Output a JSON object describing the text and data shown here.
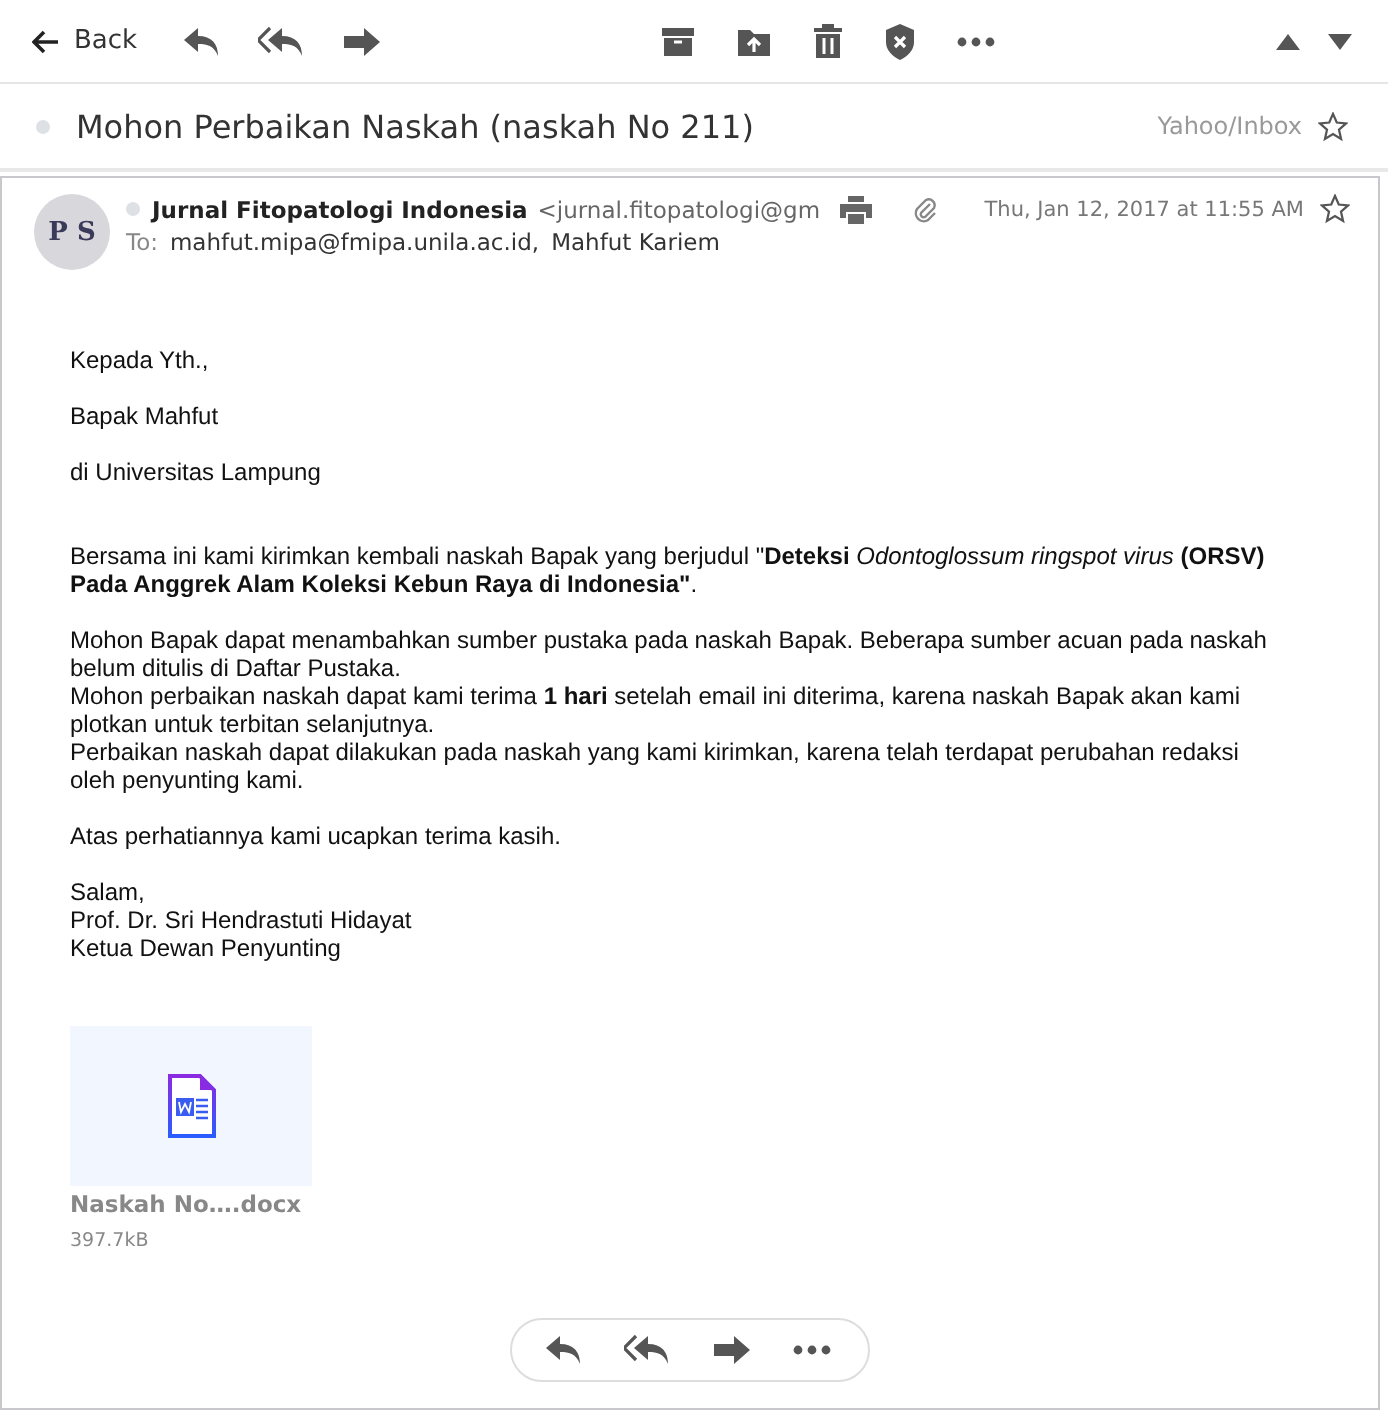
{
  "toolbar": {
    "back_label": "Back"
  },
  "subject": {
    "title": "Mohon Perbaikan Naskah (naskah No 211)",
    "folder": "Yahoo/Inbox"
  },
  "message": {
    "avatar_text": "P S",
    "sender_name": "Jurnal Fitopatologi Indonesia",
    "sender_email": "<jurnal.fitopatologi@gm",
    "date": "Thu, Jan 12, 2017 at 11:55 AM",
    "to_label": "To:",
    "recipients": [
      "mahfut.mipa@fmipa.unila.ac.id,",
      "Mahfut Kariem"
    ],
    "body": [
      {
        "lines": [
          "Kepada Yth.,"
        ]
      },
      {
        "lines": [
          "Bapak Mahfut"
        ]
      },
      {
        "lines": [
          "di Universitas Lampung"
        ]
      },
      {
        "lines": [
          "Bersama ini kami kirimkan kembali naskah Bapak yang berjudul \"**Deteksi** *Odontoglossum ringspot virus* **(ORSV) Pada Anggrek Alam Koleksi Kebun Raya di Indonesia\"**."
        ]
      },
      {
        "lines": [
          "Mohon Bapak dapat menambahkan sumber pustaka pada naskah Bapak. Beberapa sumber acuan pada naskah belum ditulis di Daftar Pustaka.",
          "Mohon perbaikan naskah dapat kami terima **1 hari** setelah email ini diterima, karena naskah Bapak akan kami plotkan untuk terbitan selanjutnya.",
          "Perbaikan naskah dapat dilakukan pada naskah yang kami kirimkan, karena telah terdapat perubahan redaksi oleh penyunting kami."
        ]
      },
      {
        "lines": [
          "Atas perhatiannya kami ucapkan terima kasih."
        ]
      },
      {
        "lines": [
          "Salam,",
          "Prof. Dr. Sri Hendrastuti Hidayat",
          "Ketua Dewan Penyunting"
        ]
      }
    ],
    "attachments": [
      {
        "name": "Naskah No….docx",
        "size": "397.7kB"
      }
    ]
  }
}
